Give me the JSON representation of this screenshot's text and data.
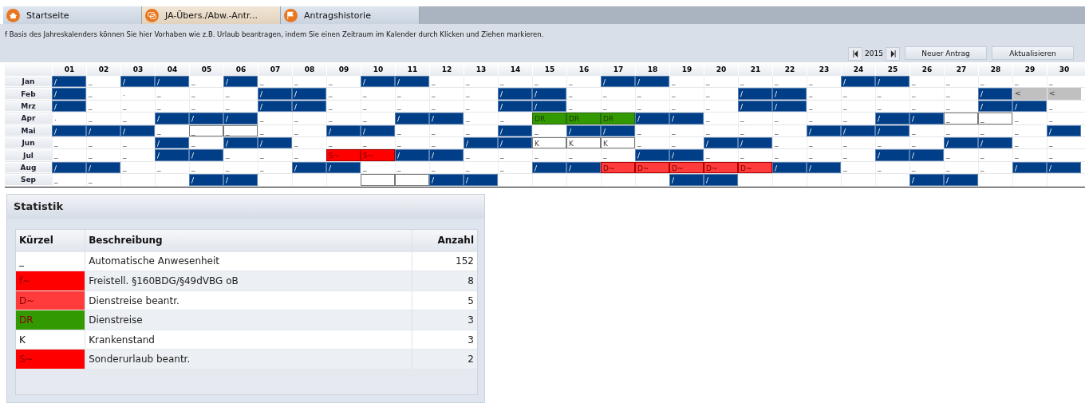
{
  "tabs": [
    {
      "label": "Startseite",
      "kind": "house",
      "selected": false
    },
    {
      "label": "JA-Übers./Abw.-Antr...",
      "kind": "chat",
      "selected": true
    },
    {
      "label": "Antragshistorie",
      "kind": "flag",
      "selected": false
    }
  ],
  "info_text": "f Basis des Jahreskalenders können Sie hier Vorhaben wie z.B. Urlaub beantragen, indem Sie einen Zeitraum im Kalender durch Klicken und Ziehen markieren.",
  "year": "2015",
  "buttons": [
    "Neuer Antrag",
    "Aktualisieren"
  ],
  "calendar": {
    "days": [
      "01",
      "02",
      "03",
      "04",
      "05",
      "06",
      "07",
      "08",
      "09",
      "10",
      "11",
      "12",
      "13",
      "14",
      "15",
      "16",
      "17",
      "18",
      "19",
      "20",
      "21",
      "22",
      "23",
      "24",
      "25",
      "26",
      "27",
      "28",
      "29",
      "30"
    ],
    "rows": [
      {
        "month": "Jan",
        "cells": [
          {
            "kind": "weekend",
            "text": "/"
          },
          {
            "kind": "present",
            "text": "_"
          },
          {
            "kind": "weekend",
            "text": "/"
          },
          {
            "kind": "weekend",
            "text": "/"
          },
          {
            "kind": "present",
            "text": "_"
          },
          {
            "kind": "weekend",
            "text": "/"
          },
          {
            "kind": "present",
            "text": "_"
          },
          {
            "kind": "present",
            "text": "_"
          },
          {
            "kind": "present",
            "text": "_"
          },
          {
            "kind": "weekend",
            "text": "/"
          },
          {
            "kind": "weekend",
            "text": "/"
          },
          {
            "kind": "present",
            "text": "_"
          },
          {
            "kind": "present",
            "text": "_"
          },
          {
            "kind": "present",
            "text": "_"
          },
          {
            "kind": "present",
            "text": "_"
          },
          {
            "kind": "present",
            "text": "_"
          },
          {
            "kind": "weekend",
            "text": "/"
          },
          {
            "kind": "weekend",
            "text": "/"
          },
          {
            "kind": "present",
            "text": "_"
          },
          {
            "kind": "present",
            "text": "_"
          },
          {
            "kind": "present",
            "text": "_"
          },
          {
            "kind": "present",
            "text": "_"
          },
          {
            "kind": "present",
            "text": "_"
          },
          {
            "kind": "weekend",
            "text": "/"
          },
          {
            "kind": "weekend",
            "text": "/"
          },
          {
            "kind": "present",
            "text": "_"
          },
          {
            "kind": "present",
            "text": "_"
          },
          {
            "kind": "present",
            "text": "_"
          },
          {
            "kind": "present",
            "text": "_"
          },
          {
            "kind": "present",
            "text": "_"
          }
        ]
      },
      {
        "month": "Feb",
        "cells": [
          {
            "kind": "weekend",
            "text": "/"
          },
          {
            "kind": "present",
            "text": "_"
          },
          {
            "kind": "present",
            "text": "."
          },
          {
            "kind": "present",
            "text": "_"
          },
          {
            "kind": "present",
            "text": "_"
          },
          {
            "kind": "present",
            "text": "_"
          },
          {
            "kind": "weekend",
            "text": "/"
          },
          {
            "kind": "weekend",
            "text": "/"
          },
          {
            "kind": "present",
            "text": "_"
          },
          {
            "kind": "present",
            "text": "_"
          },
          {
            "kind": "present",
            "text": "_"
          },
          {
            "kind": "present",
            "text": "_"
          },
          {
            "kind": "present",
            "text": "_"
          },
          {
            "kind": "weekend",
            "text": "/"
          },
          {
            "kind": "weekend",
            "text": "/"
          },
          {
            "kind": "present",
            "text": "_"
          },
          {
            "kind": "present",
            "text": "_"
          },
          {
            "kind": "present",
            "text": "_"
          },
          {
            "kind": "present",
            "text": "_"
          },
          {
            "kind": "present",
            "text": "_"
          },
          {
            "kind": "weekend",
            "text": "/"
          },
          {
            "kind": "weekend",
            "text": "/"
          },
          {
            "kind": "present",
            "text": "_"
          },
          {
            "kind": "present",
            "text": "_"
          },
          {
            "kind": "present",
            "text": "_"
          },
          {
            "kind": "present",
            "text": "_"
          },
          {
            "kind": "present",
            "text": "_"
          },
          {
            "kind": "weekend",
            "text": "/"
          },
          {
            "kind": "locked",
            "text": "<"
          },
          {
            "kind": "locked",
            "text": "<"
          }
        ]
      },
      {
        "month": "Mrz",
        "cells": [
          {
            "kind": "weekend",
            "text": "/"
          },
          {
            "kind": "present",
            "text": "_"
          },
          {
            "kind": "present",
            "text": "_"
          },
          {
            "kind": "present",
            "text": "_"
          },
          {
            "kind": "present",
            "text": "_"
          },
          {
            "kind": "present",
            "text": "_"
          },
          {
            "kind": "weekend",
            "text": "/"
          },
          {
            "kind": "weekend",
            "text": "/"
          },
          {
            "kind": "present",
            "text": "_"
          },
          {
            "kind": "present",
            "text": "_"
          },
          {
            "kind": "present",
            "text": "_"
          },
          {
            "kind": "present",
            "text": "_"
          },
          {
            "kind": "present",
            "text": "_"
          },
          {
            "kind": "weekend",
            "text": "/"
          },
          {
            "kind": "weekend",
            "text": "/"
          },
          {
            "kind": "present",
            "text": "_"
          },
          {
            "kind": "present",
            "text": "_"
          },
          {
            "kind": "present",
            "text": "_"
          },
          {
            "kind": "present",
            "text": "_"
          },
          {
            "kind": "present",
            "text": "_"
          },
          {
            "kind": "weekend",
            "text": "/"
          },
          {
            "kind": "weekend",
            "text": "/"
          },
          {
            "kind": "present",
            "text": "_"
          },
          {
            "kind": "present",
            "text": "_"
          },
          {
            "kind": "present",
            "text": "_"
          },
          {
            "kind": "present",
            "text": "_"
          },
          {
            "kind": "present",
            "text": "_"
          },
          {
            "kind": "weekend",
            "text": "/"
          },
          {
            "kind": "weekend",
            "text": "/"
          },
          {
            "kind": "present",
            "text": "_"
          }
        ]
      },
      {
        "month": "Apr",
        "cells": [
          {
            "kind": "present",
            "text": "."
          },
          {
            "kind": "present",
            "text": "_"
          },
          {
            "kind": "present",
            "text": "_"
          },
          {
            "kind": "weekend",
            "text": "/"
          },
          {
            "kind": "weekend",
            "text": "/"
          },
          {
            "kind": "weekend",
            "text": "/"
          },
          {
            "kind": "present",
            "text": "_"
          },
          {
            "kind": "present",
            "text": "_"
          },
          {
            "kind": "present",
            "text": "_"
          },
          {
            "kind": "present",
            "text": "_"
          },
          {
            "kind": "weekend",
            "text": "/"
          },
          {
            "kind": "weekend",
            "text": "/"
          },
          {
            "kind": "present",
            "text": "_"
          },
          {
            "kind": "present",
            "text": "_"
          },
          {
            "kind": "trip",
            "text": "DR"
          },
          {
            "kind": "trip",
            "text": "DR"
          },
          {
            "kind": "trip",
            "text": "DR"
          },
          {
            "kind": "weekend",
            "text": "/"
          },
          {
            "kind": "weekend",
            "text": "/"
          },
          {
            "kind": "present",
            "text": "_"
          },
          {
            "kind": "present",
            "text": "_"
          },
          {
            "kind": "present",
            "text": "_"
          },
          {
            "kind": "present",
            "text": "_"
          },
          {
            "kind": "present",
            "text": "_"
          },
          {
            "kind": "weekend",
            "text": "/"
          },
          {
            "kind": "weekend",
            "text": "/"
          },
          {
            "kind": "framed",
            "text": "_"
          },
          {
            "kind": "framed",
            "text": "_"
          },
          {
            "kind": "present",
            "text": "_"
          },
          {
            "kind": "present",
            "text": "_"
          }
        ]
      },
      {
        "month": "Mai",
        "cells": [
          {
            "kind": "weekend",
            "text": "/"
          },
          {
            "kind": "weekend",
            "text": "/"
          },
          {
            "kind": "weekend",
            "text": "/"
          },
          {
            "kind": "present",
            "text": "_"
          },
          {
            "kind": "framed",
            "text": "_"
          },
          {
            "kind": "framed",
            "text": "_"
          },
          {
            "kind": "present",
            "text": "_"
          },
          {
            "kind": "present",
            "text": "_"
          },
          {
            "kind": "weekend",
            "text": "/"
          },
          {
            "kind": "weekend",
            "text": "/"
          },
          {
            "kind": "present",
            "text": "_"
          },
          {
            "kind": "present",
            "text": "_"
          },
          {
            "kind": "present",
            "text": "_"
          },
          {
            "kind": "weekend",
            "text": "/"
          },
          {
            "kind": "present",
            "text": "_"
          },
          {
            "kind": "weekend",
            "text": "/"
          },
          {
            "kind": "weekend",
            "text": "/"
          },
          {
            "kind": "present",
            "text": "_"
          },
          {
            "kind": "present",
            "text": "_"
          },
          {
            "kind": "present",
            "text": "_"
          },
          {
            "kind": "present",
            "text": "_"
          },
          {
            "kind": "present",
            "text": "_"
          },
          {
            "kind": "weekend",
            "text": "/"
          },
          {
            "kind": "weekend",
            "text": "/"
          },
          {
            "kind": "weekend",
            "text": "/"
          },
          {
            "kind": "present",
            "text": "_"
          },
          {
            "kind": "present",
            "text": "_"
          },
          {
            "kind": "present",
            "text": "_"
          },
          {
            "kind": "present",
            "text": "_"
          },
          {
            "kind": "weekend",
            "text": "/"
          }
        ]
      },
      {
        "month": "Jun",
        "cells": [
          {
            "kind": "present",
            "text": "_"
          },
          {
            "kind": "present",
            "text": "_"
          },
          {
            "kind": "present",
            "text": "_"
          },
          {
            "kind": "weekend",
            "text": "/"
          },
          {
            "kind": "present",
            "text": "_"
          },
          {
            "kind": "weekend",
            "text": "/"
          },
          {
            "kind": "weekend",
            "text": "/"
          },
          {
            "kind": "present",
            "text": "_"
          },
          {
            "kind": "present",
            "text": "_"
          },
          {
            "kind": "present",
            "text": "_"
          },
          {
            "kind": "present",
            "text": "_"
          },
          {
            "kind": "present",
            "text": "_"
          },
          {
            "kind": "weekend",
            "text": "/"
          },
          {
            "kind": "weekend",
            "text": "/"
          },
          {
            "kind": "sick",
            "text": "K"
          },
          {
            "kind": "sick",
            "text": "K"
          },
          {
            "kind": "sick",
            "text": "K"
          },
          {
            "kind": "present",
            "text": "_"
          },
          {
            "kind": "present",
            "text": "_"
          },
          {
            "kind": "weekend",
            "text": "/"
          },
          {
            "kind": "weekend",
            "text": "/"
          },
          {
            "kind": "present",
            "text": "_"
          },
          {
            "kind": "present",
            "text": "_"
          },
          {
            "kind": "present",
            "text": "_"
          },
          {
            "kind": "present",
            "text": "_"
          },
          {
            "kind": "present",
            "text": "_"
          },
          {
            "kind": "weekend",
            "text": "/"
          },
          {
            "kind": "weekend",
            "text": "/"
          },
          {
            "kind": "present",
            "text": "_"
          },
          {
            "kind": "present",
            "text": "_"
          }
        ]
      },
      {
        "month": "Jul",
        "cells": [
          {
            "kind": "present",
            "text": "_"
          },
          {
            "kind": "present",
            "text": "_"
          },
          {
            "kind": "present",
            "text": "_"
          },
          {
            "kind": "weekend",
            "text": "/"
          },
          {
            "kind": "weekend",
            "text": "/"
          },
          {
            "kind": "present",
            "text": "_"
          },
          {
            "kind": "present",
            "text": "_"
          },
          {
            "kind": "present",
            "text": "_"
          },
          {
            "kind": "leave",
            "text": "S~"
          },
          {
            "kind": "leave",
            "text": "S~"
          },
          {
            "kind": "weekend",
            "text": "/"
          },
          {
            "kind": "weekend",
            "text": "/"
          },
          {
            "kind": "present",
            "text": "_"
          },
          {
            "kind": "present",
            "text": "_"
          },
          {
            "kind": "present",
            "text": "_"
          },
          {
            "kind": "present",
            "text": "_"
          },
          {
            "kind": "present",
            "text": "_"
          },
          {
            "kind": "weekend",
            "text": "/"
          },
          {
            "kind": "weekend",
            "text": "/"
          },
          {
            "kind": "present",
            "text": "_"
          },
          {
            "kind": "present",
            "text": "_"
          },
          {
            "kind": "present",
            "text": "_"
          },
          {
            "kind": "present",
            "text": "_"
          },
          {
            "kind": "present",
            "text": "_"
          },
          {
            "kind": "weekend",
            "text": "/"
          },
          {
            "kind": "weekend",
            "text": "/"
          },
          {
            "kind": "present",
            "text": "_"
          },
          {
            "kind": "present",
            "text": "_"
          },
          {
            "kind": "present",
            "text": "_"
          },
          {
            "kind": "present",
            "text": "_"
          }
        ]
      },
      {
        "month": "Aug",
        "cells": [
          {
            "kind": "weekend",
            "text": "/"
          },
          {
            "kind": "weekend",
            "text": "/"
          },
          {
            "kind": "present",
            "text": "_"
          },
          {
            "kind": "present",
            "text": "_"
          },
          {
            "kind": "present",
            "text": "_"
          },
          {
            "kind": "present",
            "text": "_"
          },
          {
            "kind": "present",
            "text": "_"
          },
          {
            "kind": "weekend",
            "text": "/"
          },
          {
            "kind": "weekend",
            "text": "/"
          },
          {
            "kind": "present",
            "text": "_"
          },
          {
            "kind": "present",
            "text": "_"
          },
          {
            "kind": "present",
            "text": "_"
          },
          {
            "kind": "present",
            "text": "_"
          },
          {
            "kind": "present",
            "text": "_"
          },
          {
            "kind": "weekend",
            "text": "/"
          },
          {
            "kind": "weekend",
            "text": "/"
          },
          {
            "kind": "request",
            "text": "D~"
          },
          {
            "kind": "request",
            "text": "D~"
          },
          {
            "kind": "request",
            "text": "D~"
          },
          {
            "kind": "request",
            "text": "D~"
          },
          {
            "kind": "request",
            "text": "D~"
          },
          {
            "kind": "weekend",
            "text": "/"
          },
          {
            "kind": "weekend",
            "text": "/"
          },
          {
            "kind": "present",
            "text": "_"
          },
          {
            "kind": "present",
            "text": "_"
          },
          {
            "kind": "present",
            "text": "_"
          },
          {
            "kind": "present",
            "text": "_"
          },
          {
            "kind": "present",
            "text": "_"
          },
          {
            "kind": "weekend",
            "text": "/"
          },
          {
            "kind": "weekend",
            "text": "/"
          }
        ]
      },
      {
        "month": "Sep",
        "cells": [
          {
            "kind": "present",
            "text": "_"
          },
          {
            "kind": "present",
            "text": "_"
          },
          {
            "kind": "blank"
          },
          {
            "kind": "blank"
          },
          {
            "kind": "weekend",
            "text": "/"
          },
          {
            "kind": "weekend",
            "text": "/"
          },
          {
            "kind": "blank"
          },
          {
            "kind": "blank"
          },
          {
            "kind": "blank"
          },
          {
            "kind": "framed"
          },
          {
            "kind": "framed"
          },
          {
            "kind": "weekend",
            "text": "/"
          },
          {
            "kind": "weekend",
            "text": "/"
          },
          {
            "kind": "blank"
          },
          {
            "kind": "blank"
          },
          {
            "kind": "blank"
          },
          {
            "kind": "blank"
          },
          {
            "kind": "blank"
          },
          {
            "kind": "weekend",
            "text": "/"
          },
          {
            "kind": "weekend",
            "text": "/"
          },
          {
            "kind": "blank"
          },
          {
            "kind": "blank"
          },
          {
            "kind": "blank"
          },
          {
            "kind": "blank"
          },
          {
            "kind": "blank"
          },
          {
            "kind": "weekend",
            "text": "/"
          },
          {
            "kind": "weekend",
            "text": "/"
          },
          {
            "kind": "blank"
          },
          {
            "kind": "blank"
          },
          {
            "kind": "blank"
          }
        ]
      }
    ]
  },
  "statistics": {
    "title": "Statistik",
    "columns": [
      "Kürzel",
      "Beschreibung",
      "Anzahl"
    ],
    "rows": [
      {
        "code": "_",
        "color": "#ffffff",
        "description": "Automatische Anwesenheit",
        "count": "152"
      },
      {
        "code": "f~",
        "color": "#ff0000",
        "description": "Freistell. §160BDG/§49dVBG oB",
        "count": "8"
      },
      {
        "code": "D~",
        "color": "#ff3b3b",
        "description": "Dienstreise beantr.",
        "count": "5"
      },
      {
        "code": "DR",
        "color": "#339900",
        "description": "Dienstreise",
        "count": "3"
      },
      {
        "code": "K",
        "color": "#ffffff",
        "description": "Krankenstand",
        "count": "3"
      },
      {
        "code": "S~",
        "color": "#ff0000",
        "description": "Sonderurlaub beantr.",
        "count": "2"
      }
    ]
  }
}
